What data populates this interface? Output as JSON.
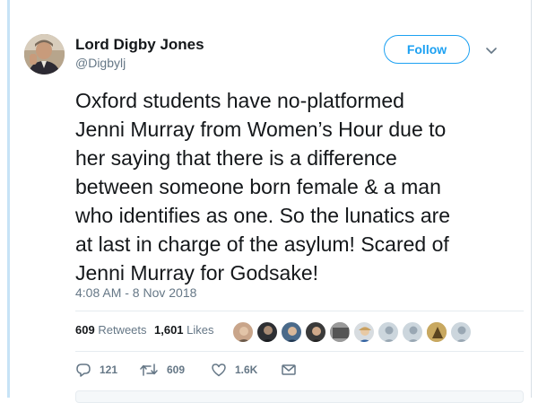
{
  "author": {
    "name": "Lord Digby Jones",
    "handle": "@Digbylj"
  },
  "follow_label": "Follow",
  "tweet": {
    "lines": [
      "Oxford students have no-platformed",
      "Jenni Murray from Women’s Hour due to",
      "her saying that there is a difference",
      "between someone born female & a man",
      "who identifies as one. So the lunatics are",
      "at last in charge of the asylum! Scared of",
      "Jenni Murray for Godsake!"
    ],
    "timestamp": "4:08 AM - 8 Nov 2018"
  },
  "stats": {
    "retweets_count": "609",
    "retweets_label": "Retweets",
    "likes_count": "1,601",
    "likes_label": "Likes"
  },
  "actions": {
    "reply_count": "121",
    "retweet_count": "609",
    "like_count": "1.6K"
  },
  "colors": {
    "accent": "#1da1f2",
    "muted": "#657786",
    "text": "#14171a"
  }
}
